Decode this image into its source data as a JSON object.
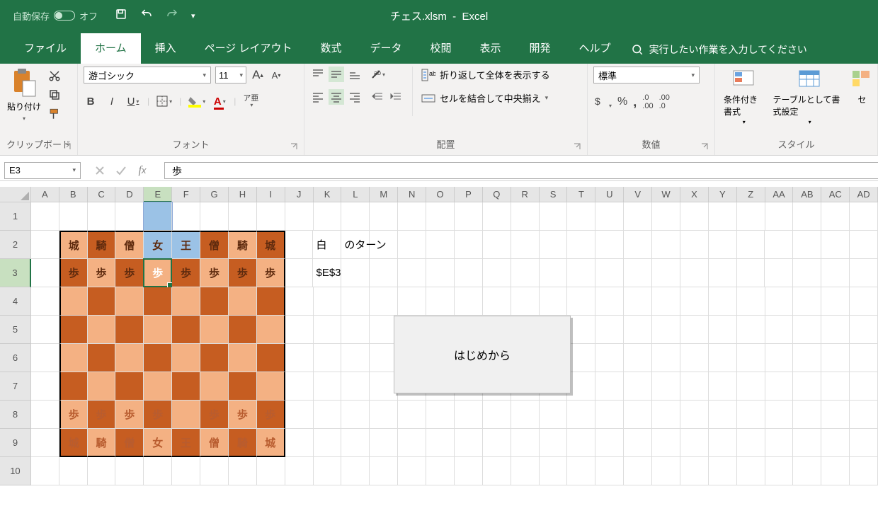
{
  "title_bar": {
    "autosave_label": "自動保存",
    "autosave_state": "オフ",
    "filename": "チェス.xlsm",
    "app": "Excel"
  },
  "tabs": {
    "file": "ファイル",
    "home": "ホーム",
    "insert": "挿入",
    "page_layout": "ページ レイアウト",
    "formulas": "数式",
    "data": "データ",
    "review": "校閲",
    "view": "表示",
    "developer": "開発",
    "help": "ヘルプ",
    "search_placeholder": "実行したい作業を入力してください"
  },
  "ribbon": {
    "clipboard": {
      "paste": "貼り付け",
      "group": "クリップボード"
    },
    "font": {
      "name": "游ゴシック",
      "size": "11",
      "group": "フォント",
      "ruby": "ア亜"
    },
    "alignment": {
      "wrap": "折り返して全体を表示する",
      "merge": "セルを結合して中央揃え",
      "group": "配置"
    },
    "number": {
      "format": "標準",
      "group": "数値"
    },
    "styles": {
      "cond": "条件付き書式",
      "table": "テーブルとして書式設定",
      "cell": "セルのスタイル",
      "group": "スタイル"
    }
  },
  "formula_bar": {
    "name_box": "E3",
    "value": "歩"
  },
  "columns": [
    "A",
    "B",
    "C",
    "D",
    "E",
    "F",
    "G",
    "H",
    "I",
    "J",
    "K",
    "L",
    "M",
    "N",
    "O",
    "P",
    "Q",
    "R",
    "S",
    "T",
    "U",
    "V",
    "W",
    "X",
    "Y",
    "Z",
    "AA",
    "AB",
    "AC",
    "AD"
  ],
  "highlighted_col": "E",
  "highlighted_row": 3,
  "board": {
    "row2": [
      "城",
      "騎",
      "僧",
      "女",
      "王",
      "僧",
      "騎",
      "城"
    ],
    "row3": [
      "歩",
      "歩",
      "歩",
      "歩",
      "歩",
      "歩",
      "歩",
      "歩"
    ],
    "row8": [
      "歩",
      "歩",
      "歩",
      "歩",
      "",
      "歩",
      "歩",
      "歩"
    ],
    "row9": [
      "城",
      "騎",
      "僧",
      "女",
      "王",
      "僧",
      "騎",
      "城"
    ]
  },
  "info": {
    "k2": "白",
    "l2": "のターン",
    "k3": "$E$3"
  },
  "button": "はじめから"
}
